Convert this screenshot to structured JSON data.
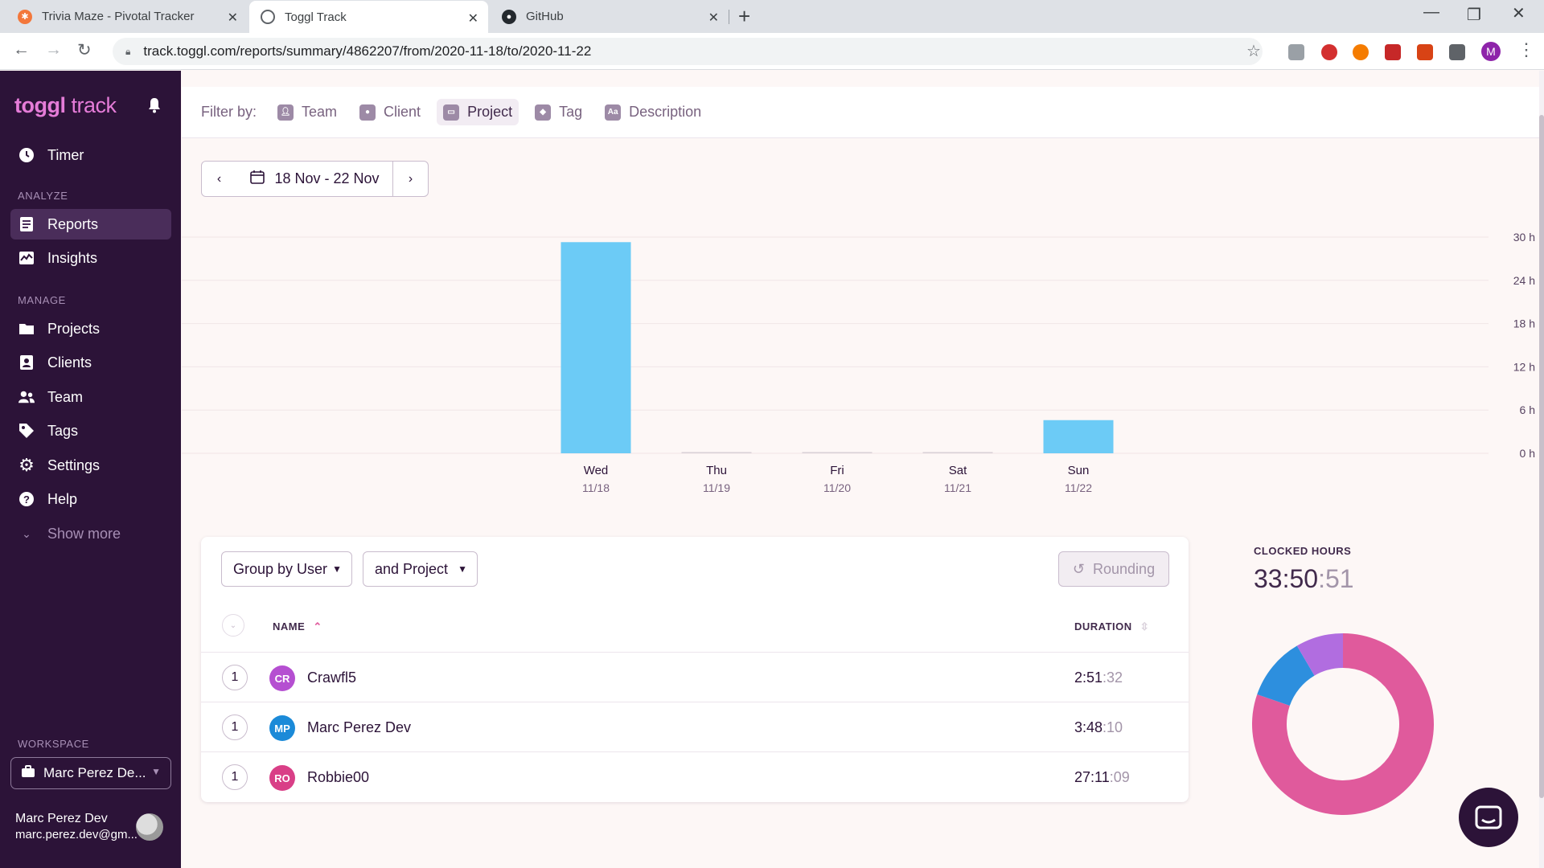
{
  "browser": {
    "tabs": [
      {
        "title": "Trivia Maze - Pivotal Tracker",
        "icon": "pivotal-tracker-icon"
      },
      {
        "title": "Toggl Track",
        "icon": "toggl-icon",
        "active": true
      },
      {
        "title": "GitHub",
        "icon": "github-icon"
      }
    ],
    "url": "track.toggl.com/reports/summary/4862207/from/2020-11-18/to/2020-11-22"
  },
  "sidebar": {
    "logo_bold": "toggl",
    "logo_light": " track",
    "timer": "Timer",
    "analyze_section": "ANALYZE",
    "reports": "Reports",
    "insights": "Insights",
    "manage_section": "MANAGE",
    "projects": "Projects",
    "clients": "Clients",
    "team": "Team",
    "tags": "Tags",
    "settings": "Settings",
    "help": "Help",
    "show_more": "Show more",
    "workspace_section": "WORKSPACE",
    "workspace_name": "Marc Perez De...",
    "user_name": "Marc Perez Dev",
    "user_email": "marc.perez.dev@gm..."
  },
  "filters": {
    "label": "Filter by:",
    "items": [
      "Team",
      "Client",
      "Project",
      "Tag",
      "Description"
    ],
    "active": "Project"
  },
  "date_range": "18 Nov - 22 Nov",
  "chart_data": {
    "type": "bar",
    "categories": [
      "Wed",
      "Thu",
      "Fri",
      "Sat",
      "Sun"
    ],
    "dates": [
      "11/18",
      "11/19",
      "11/20",
      "11/21",
      "11/22"
    ],
    "values": [
      29.3,
      0,
      0,
      0.03,
      4.6
    ],
    "unit": "h",
    "ylim": [
      0,
      30
    ],
    "yticks": [
      "0 h",
      "6 h",
      "12 h",
      "18 h",
      "24 h",
      "30 h"
    ],
    "grid": true,
    "color": "#6ccbf6"
  },
  "table": {
    "group_by": "Group by User",
    "sub_group": "and Project",
    "rounding": "Rounding",
    "col_name": "NAME",
    "col_duration": "DURATION",
    "rows": [
      {
        "count": "1",
        "initials": "CR",
        "name": "Crawfl5",
        "duration_main": "2:51",
        "duration_sec": ":32",
        "color": "#b54fd1"
      },
      {
        "count": "1",
        "initials": "MP",
        "name": "Marc Perez Dev",
        "duration_main": "3:48",
        "duration_sec": ":10",
        "color": "#1b8ad8"
      },
      {
        "count": "1",
        "initials": "RO",
        "name": "Robbie00",
        "duration_main": "27:11",
        "duration_sec": ":09",
        "color": "#d93f87"
      }
    ]
  },
  "clocked": {
    "label": "CLOCKED HOURS",
    "main": "33:50",
    "sec": ":51"
  },
  "donut_data": {
    "type": "pie",
    "slices": [
      {
        "name": "Robbie00",
        "value": 27.186,
        "color": "#e05a9c"
      },
      {
        "name": "Marc Perez Dev",
        "value": 3.803,
        "color": "#2d8fde"
      },
      {
        "name": "Crawfl5",
        "value": 2.859,
        "color": "#b16de0"
      }
    ]
  }
}
